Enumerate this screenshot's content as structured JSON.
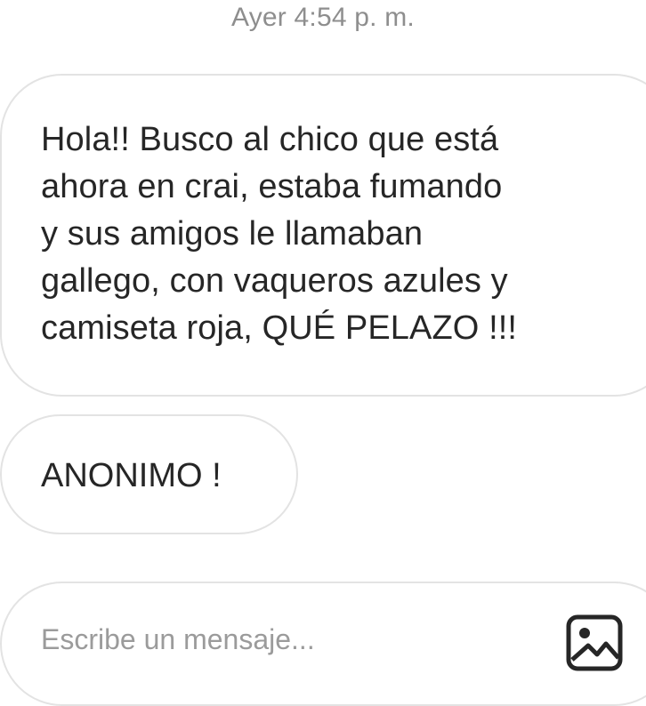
{
  "thread": {
    "timestamp": "Ayer 4:54 p. m.",
    "messages": [
      {
        "text": "Hola!! Busco al chico que está\nahora en crai, estaba fumando\ny sus amigos le llamaban\ngallego, con vaqueros azules y\ncamiseta roja, QUÉ PELAZO !!!"
      },
      {
        "text": "ANONIMO !"
      }
    ]
  },
  "composer": {
    "placeholder": "Escribe un mensaje...",
    "value": "",
    "gallery_icon": "image-gallery-icon"
  },
  "colors": {
    "bubble_border": "#e3e3e3",
    "text": "#262626",
    "muted": "#8e8e8e"
  }
}
